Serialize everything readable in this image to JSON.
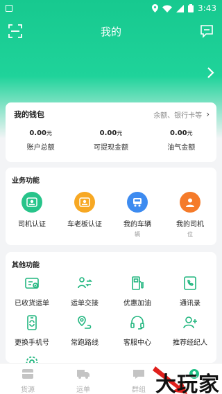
{
  "status_bar": {
    "time": "3:43"
  },
  "header": {
    "title": "我的"
  },
  "wallet": {
    "title": "我的钱包",
    "subtitle": "余额、银行卡等",
    "items": [
      {
        "amount": "0.00",
        "unit": "元",
        "label": "账户总额"
      },
      {
        "amount": "0.00",
        "unit": "元",
        "label": "可提现金额"
      },
      {
        "amount": "0.00",
        "unit": "元",
        "label": "油气金额"
      }
    ]
  },
  "business": {
    "title": "业务功能",
    "items": [
      {
        "label": "司机认证",
        "sub": "",
        "icon": "driver-id-icon",
        "color": "#27c48a"
      },
      {
        "label": "车老板认证",
        "sub": "",
        "icon": "owner-id-icon",
        "color": "#f7a823"
      },
      {
        "label": "我的车辆",
        "sub": "辆",
        "icon": "truck-icon",
        "color": "#3d8bf0"
      },
      {
        "label": "我的司机",
        "sub": "位",
        "icon": "driver-icon",
        "color": "#f57b2a"
      }
    ]
  },
  "other": {
    "title": "其他功能",
    "items": [
      {
        "label": "已收货运单",
        "icon": "received-waybill-icon"
      },
      {
        "label": "运单交接",
        "icon": "handover-icon"
      },
      {
        "label": "优惠加油",
        "icon": "fuel-icon"
      },
      {
        "label": "通讯录",
        "icon": "contacts-icon"
      },
      {
        "label": "更换手机号",
        "icon": "phone-change-icon"
      },
      {
        "label": "常跑路线",
        "icon": "route-icon"
      },
      {
        "label": "客服中心",
        "icon": "headset-icon"
      },
      {
        "label": "推荐经纪人",
        "icon": "add-user-icon"
      },
      {
        "label": "",
        "icon": "settings-icon"
      }
    ]
  },
  "tabs": [
    {
      "label": "货源",
      "icon": "cargo-icon"
    },
    {
      "label": "运单",
      "icon": "truck-tab-icon"
    },
    {
      "label": "群组",
      "icon": "group-icon"
    },
    {
      "label": "",
      "icon": "profile-tab-icon"
    }
  ],
  "watermark": {
    "text": "大玩家"
  },
  "colors": {
    "primary": "#17c98f",
    "accent_green": "#21b67f"
  }
}
